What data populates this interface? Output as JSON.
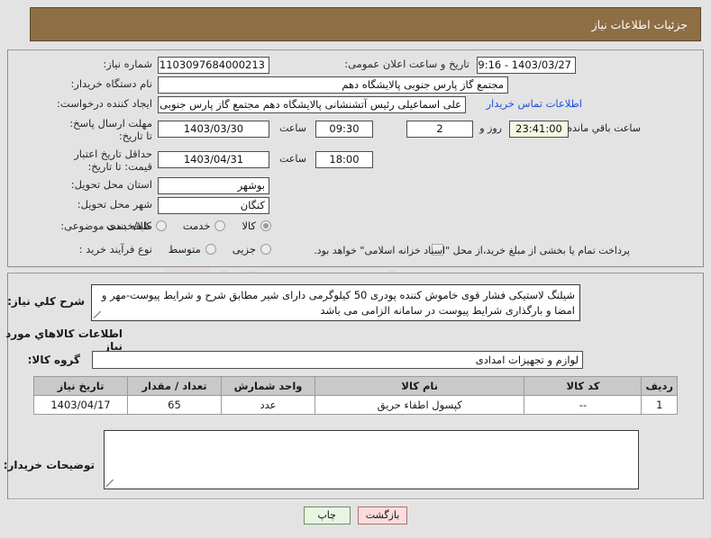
{
  "header": {
    "title": "جزئیات اطلاعات نیاز"
  },
  "form": {
    "need_number_label": "شماره نیاز:",
    "need_number_value": "1103097684000213",
    "announce_label": "تاریخ و ساعت اعلان عمومی:",
    "announce_value": "1403/03/27 - 09:16",
    "buyer_org_label": "نام دستگاه خریدار:",
    "buyer_org_value": "مجتمع گاز پارس جنوبی  پالایشگاه دهم",
    "creator_label": "ایجاد کننده درخواست:",
    "creator_value": "علی اسماعیلی رئیس آتشنشانی پالایشگاه دهم مجتمع گاز پارس جنوبی  پالای",
    "contact_link": "اطلاعات تماس خریدار",
    "deadline_label": "مهلت ارسال پاسخ: تا تاریخ:",
    "deadline_date": "1403/03/30",
    "hour_label": "ساعت",
    "deadline_time": "09:30",
    "days_remaining": "2",
    "days_word": "روز و",
    "time_remaining": "23:41:00",
    "remaining_label": "ساعت باقي مانده",
    "validity_label": "حداقل تاریخ اعتبار قیمت: تا تاریخ:",
    "validity_date": "1403/04/31",
    "validity_time": "18:00",
    "province_label": "استان محل تحویل:",
    "province_value": "بوشهر",
    "city_label": "شهر محل تحویل:",
    "city_value": "کنگان",
    "category_label": "طبقه بندی موضوعی:",
    "category_options": [
      {
        "label": "کالا",
        "selected": true
      },
      {
        "label": "خدمت",
        "selected": false
      },
      {
        "label": "کالا/خدمت",
        "selected": false
      }
    ],
    "process_label": "نوع فرآیند خرید :",
    "process_options": [
      {
        "label": "جزیی",
        "selected": false
      },
      {
        "label": "متوسط",
        "selected": false
      }
    ],
    "treasury_note": "پرداخت تمام یا بخشی از مبلغ خرید،از محل \"اسناد خزانه اسلامی\" خواهد بود."
  },
  "description": {
    "label": "شرح کلي نیاز:",
    "value": "شیلنگ لاستیکی فشار قوی خاموش کننده پودری 50 کیلوگرمی دارای شیر مطابق شرح و شرایط پیوست-مهر و امضا و بارگذاری شرایط پیوست در سامانه الزامی می باشد"
  },
  "goods_section": {
    "title": "اطلاعات کالاهاي مورد نیاز",
    "group_label": "گروه کالا:",
    "group_value": "لوازم و تجهیزات امدادی"
  },
  "table": {
    "columns": [
      "ردیف",
      "کد کالا",
      "نام کالا",
      "واحد شمارش",
      "تعداد / مقدار",
      "تاریخ نیاز"
    ],
    "rows": [
      {
        "row": "1",
        "code": "--",
        "name": "کپسول اطفاء حریق",
        "unit": "عدد",
        "quantity": "65",
        "need_date": "1403/04/17"
      }
    ]
  },
  "buyer_notes": {
    "label": "توضیحات خریدار:",
    "value": ""
  },
  "footer": {
    "print_label": "چاپ",
    "back_label": "بازگشت"
  },
  "colors": {
    "header_bg": "#8d6e45",
    "page_bg": "#e3e3e3",
    "link": "#1f4fd8",
    "table_header_bg": "#c9c9c9",
    "print_btn_bg": "#e7f5e2",
    "back_btn_bg": "#fadcdc"
  }
}
